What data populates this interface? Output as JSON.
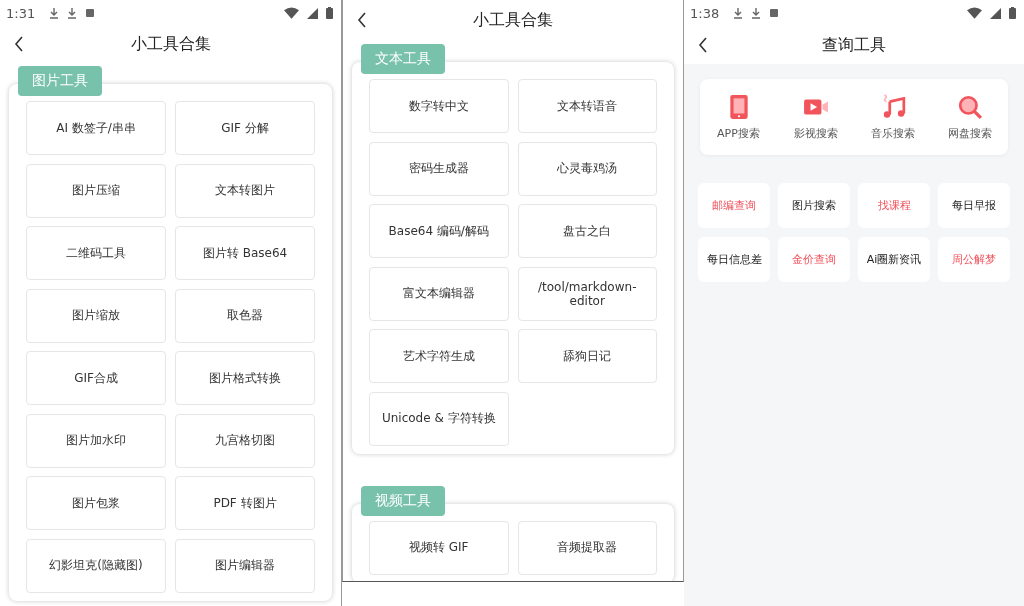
{
  "screens": [
    {
      "kind": "tools",
      "status_time": "1:31",
      "title": "小工具合集",
      "sections": [
        {
          "label": "图片工具",
          "items": [
            "AI 数签子/串串",
            "GIF 分解",
            "图片压缩",
            "文本转图片",
            "二维码工具",
            "图片转 Base64",
            "图片缩放",
            "取色器",
            "GIF合成",
            "图片格式转换",
            "图片加水印",
            "九宫格切图",
            "图片包浆",
            "PDF 转图片",
            "幻影坦克(隐藏图)",
            "图片编辑器"
          ]
        }
      ]
    },
    {
      "kind": "tools",
      "title": "小工具合集",
      "sections": [
        {
          "label": "文本工具",
          "items": [
            "数字转中文",
            "文本转语音",
            "密码生成器",
            "心灵毒鸡汤",
            "Base64 编码/解码",
            "盘古之白",
            "富文本编辑器",
            "/tool/markdown-editor",
            "艺术字符生成",
            "舔狗日记",
            "Unicode & 字符转换"
          ]
        },
        {
          "label": "视频工具",
          "items": [
            "视频转 GIF",
            "音频提取器"
          ]
        }
      ]
    },
    {
      "kind": "query",
      "status_time": "1:38",
      "title": "查询工具",
      "features": [
        {
          "label": "APP搜索",
          "kind": "tablet"
        },
        {
          "label": "影视搜索",
          "kind": "video"
        },
        {
          "label": "音乐搜索",
          "kind": "music"
        },
        {
          "label": "网盘搜索",
          "kind": "search"
        }
      ],
      "chips": [
        {
          "label": "邮编查询",
          "highlighted": true
        },
        {
          "label": "图片搜索",
          "highlighted": false
        },
        {
          "label": "找课程",
          "highlighted": true
        },
        {
          "label": "每日早报",
          "highlighted": false
        },
        {
          "label": "每日信息差",
          "highlighted": false
        },
        {
          "label": "金价查询",
          "highlighted": true
        },
        {
          "label": "Ai圈新资讯",
          "highlighted": false
        },
        {
          "label": "周公解梦",
          "highlighted": true
        }
      ]
    }
  ]
}
